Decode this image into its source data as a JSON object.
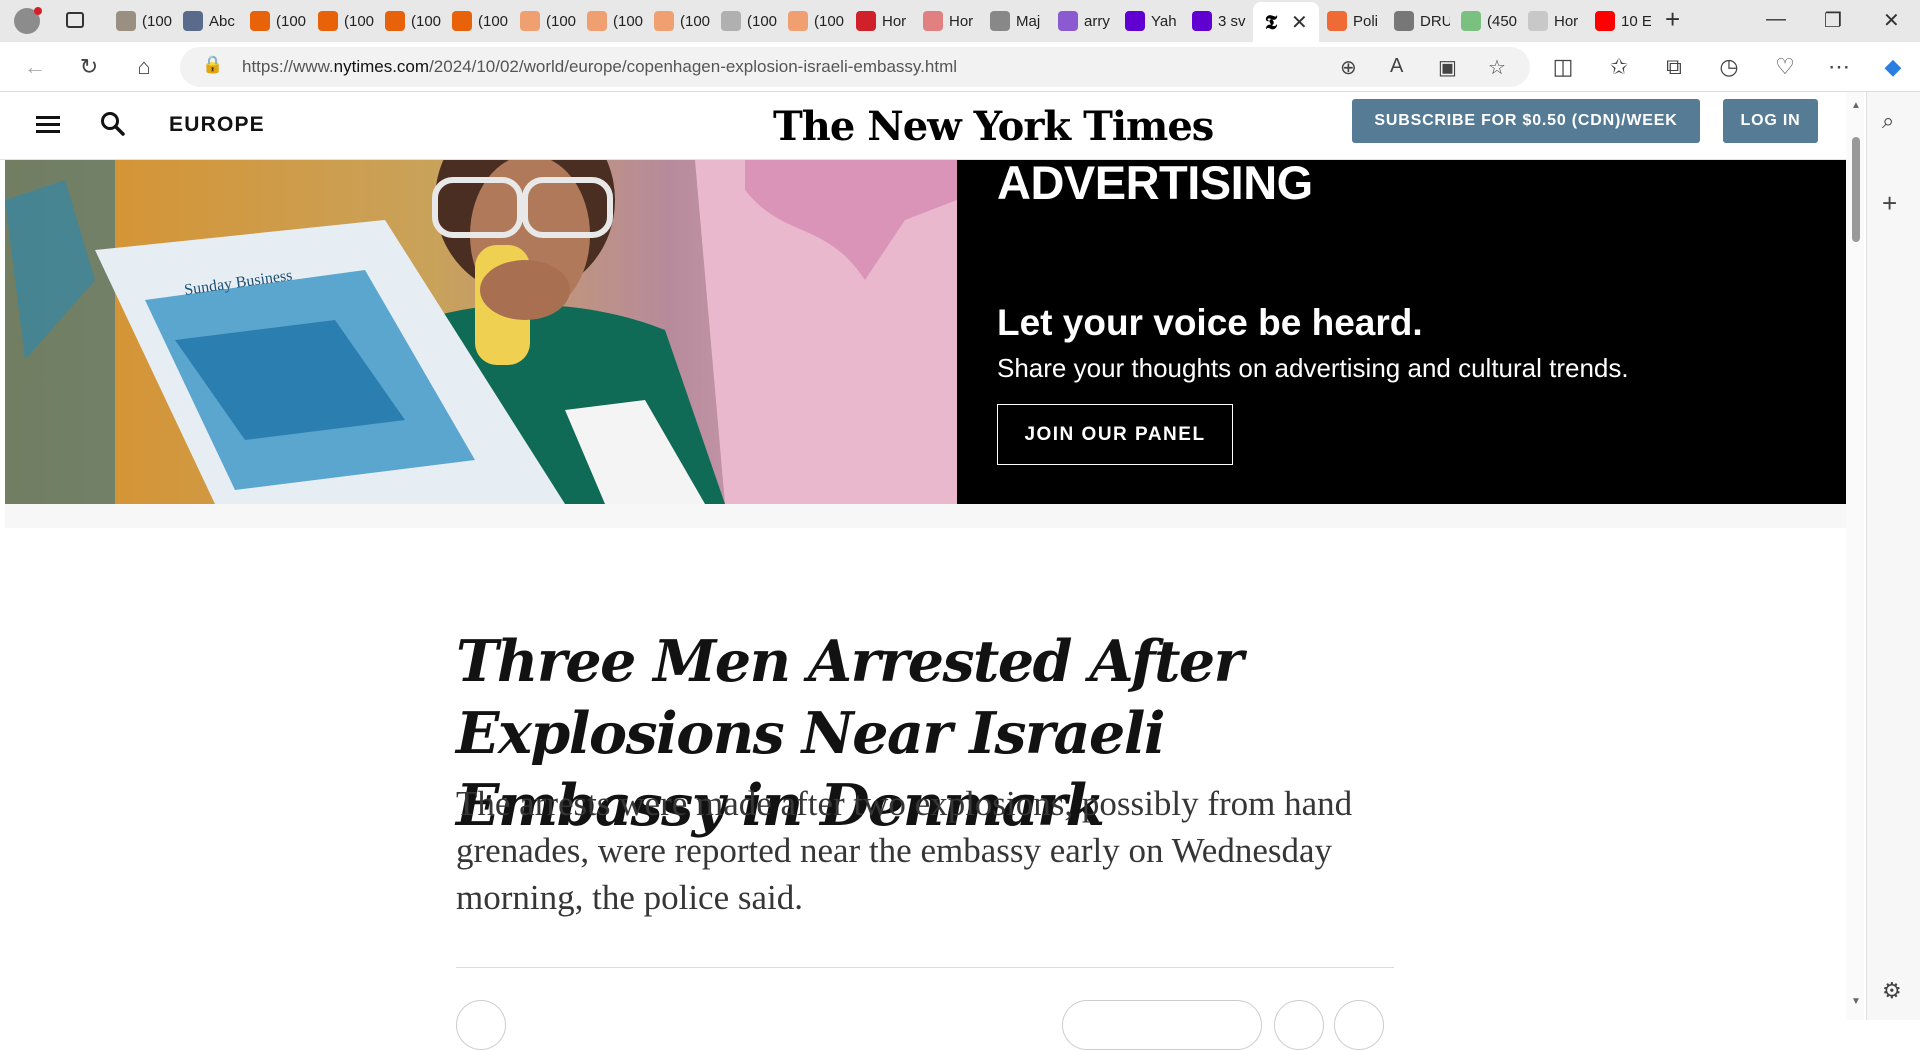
{
  "browser": {
    "tabs": [
      {
        "title": "(100",
        "icon": "image-icon",
        "color": "#9a8f80"
      },
      {
        "title": "Abc",
        "icon": "va-icon",
        "color": "#5a6a8a"
      },
      {
        "title": "(100",
        "icon": "bookmark-icon",
        "color": "#e8620a"
      },
      {
        "title": "(100",
        "icon": "bookmark-icon",
        "color": "#e8620a"
      },
      {
        "title": "(100",
        "icon": "bookmark-icon",
        "color": "#e8620a"
      },
      {
        "title": "(100",
        "icon": "bookmark-icon",
        "color": "#e8620a"
      },
      {
        "title": "(100",
        "icon": "bookmark-icon",
        "color": "#f0a070"
      },
      {
        "title": "(100",
        "icon": "bookmark-icon",
        "color": "#f0a070"
      },
      {
        "title": "(100",
        "icon": "bookmark-icon",
        "color": "#f0a070"
      },
      {
        "title": "(100",
        "icon": "image-icon",
        "color": "#b0b0b0"
      },
      {
        "title": "(100",
        "icon": "bookmark-icon",
        "color": "#f0a070"
      },
      {
        "title": "Hor",
        "icon": "red-icon",
        "color": "#d0202a"
      },
      {
        "title": "Hor",
        "icon": "red-icon",
        "color": "#e08080"
      },
      {
        "title": "Maj",
        "icon": "search-icon",
        "color": "#888888"
      },
      {
        "title": "arry",
        "icon": "yahoo-icon",
        "color": "#8c5ad0"
      },
      {
        "title": "Yah",
        "icon": "yahoo-icon",
        "color": "#6001d2"
      },
      {
        "title": "3 sv",
        "icon": "yahoo-icon",
        "color": "#6001d2"
      },
      {
        "title": "",
        "icon": "nyt-icon",
        "color": "#000000"
      },
      {
        "title": "Poli",
        "icon": "b-icon",
        "color": "#f06a35"
      },
      {
        "title": "DRU",
        "icon": "stripes-icon",
        "color": "#777777"
      },
      {
        "title": "(450",
        "icon": "g-icon",
        "color": "#7ac080"
      },
      {
        "title": "Hor",
        "icon": "bird-icon",
        "color": "#c8c8c8"
      },
      {
        "title": "10 E",
        "icon": "youtube-icon",
        "color": "#ff0000"
      }
    ],
    "url_prefix": "https://www.",
    "url_domain": "nytimes.com",
    "url_path": "/2024/10/02/world/europe/copenhagen-explosion-israeli-embassy.html"
  },
  "header": {
    "section": "EUROPE",
    "logo": "The New York Times",
    "subscribe_label": "SUBSCRIBE FOR $0.50 (CDN)/WEEK",
    "login_label": "LOG IN"
  },
  "ad": {
    "heading": "ADVERTISING",
    "line1": "Let your voice be heard.",
    "line2": "Share your thoughts on advertising and cultural trends.",
    "cta": "JOIN OUR PANEL",
    "newspaper_text": "Sunday Business"
  },
  "article": {
    "headline": "Three Men Arrested After Explosions Near Israeli Embassy in Denmark",
    "summary": "The arrests were made after two explosions, possibly from hand grenades, were reported near the embassy early on Wednesday morning, the police said."
  }
}
